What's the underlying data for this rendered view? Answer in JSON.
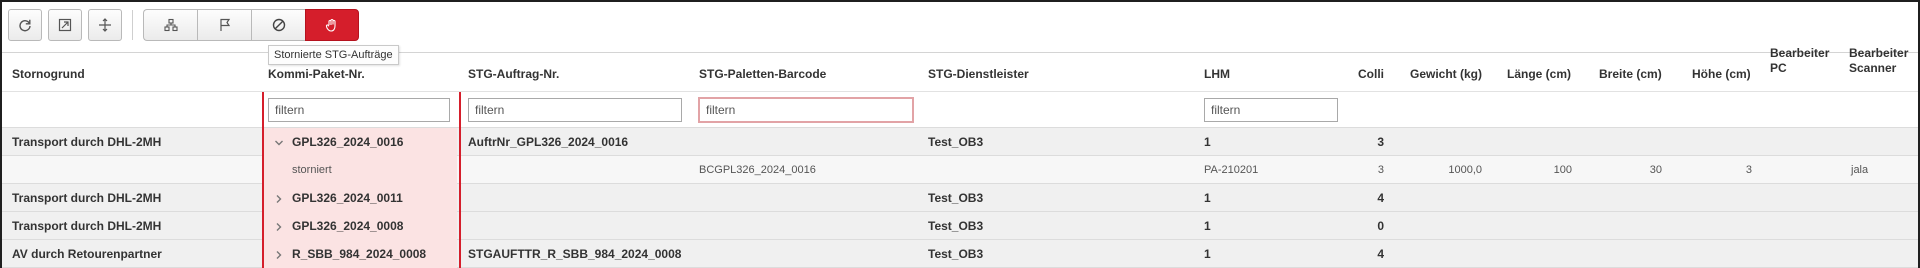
{
  "tooltip": "Stornierte STG-Aufträge",
  "toolbar": {
    "buttons": [
      {
        "icon": "refresh-icon"
      },
      {
        "icon": "expand-icon"
      },
      {
        "icon": "move-icon"
      }
    ],
    "group": [
      {
        "icon": "hierarchy-icon"
      },
      {
        "icon": "flag-icon"
      },
      {
        "icon": "cancel-icon"
      },
      {
        "icon": "hand-icon",
        "active": true
      }
    ],
    "accent": "#d51e2b"
  },
  "columns": {
    "stornogrund": "Stornogrund",
    "kommi": "Kommi-Paket-Nr.",
    "auftrag": "STG-Auftrag-Nr.",
    "barcode": "STG-Paletten-Barcode",
    "dienstleister": "STG-Dienstleister",
    "lhm": "LHM",
    "colli": "Colli",
    "gewicht": "Gewicht (kg)",
    "laenge": "Länge (cm)",
    "breite": "Breite (cm)",
    "hoehe": "Höhe (cm)",
    "bearbeiter_pc": "Bearbeiter PC",
    "bearbeiter_scanner": "Bearbeiter Scanner"
  },
  "filter": {
    "placeholder": "filtern",
    "kommi": "",
    "auftrag": "",
    "barcode": "",
    "lhm": ""
  },
  "rows": [
    {
      "type": "group",
      "expanded": true,
      "stornogrund": "Transport durch DHL-2MH",
      "kommi": "GPL326_2024_0016",
      "auftrag": "AuftrNr_GPL326_2024_0016",
      "dienstleister": "Test_OB3",
      "lhm": "1",
      "colli": "3"
    },
    {
      "type": "detail",
      "kommi": "storniert",
      "barcode": "BCGPL326_2024_0016",
      "lhm": "PA-210201",
      "colli": "3",
      "gewicht": "1000,0",
      "laenge": "100",
      "breite": "30",
      "hoehe": "3",
      "bearbeiter_pc": "",
      "bearbeiter_scanner": "jala"
    },
    {
      "type": "group",
      "expanded": false,
      "stornogrund": "Transport durch DHL-2MH",
      "kommi": "GPL326_2024_0011",
      "auftrag": "",
      "dienstleister": "Test_OB3",
      "lhm": "1",
      "colli": "4"
    },
    {
      "type": "group",
      "expanded": false,
      "stornogrund": "Transport durch DHL-2MH",
      "kommi": "GPL326_2024_0008",
      "auftrag": "",
      "dienstleister": "Test_OB3",
      "lhm": "1",
      "colli": "0"
    },
    {
      "type": "group",
      "expanded": false,
      "stornogrund": "AV durch Retourenpartner",
      "kommi": "R_SBB_984_2024_0008",
      "auftrag": "STGAUFTTR_R_SBB_984_2024_0008",
      "dienstleister": "Test_OB3",
      "lhm": "1",
      "colli": "4"
    }
  ]
}
